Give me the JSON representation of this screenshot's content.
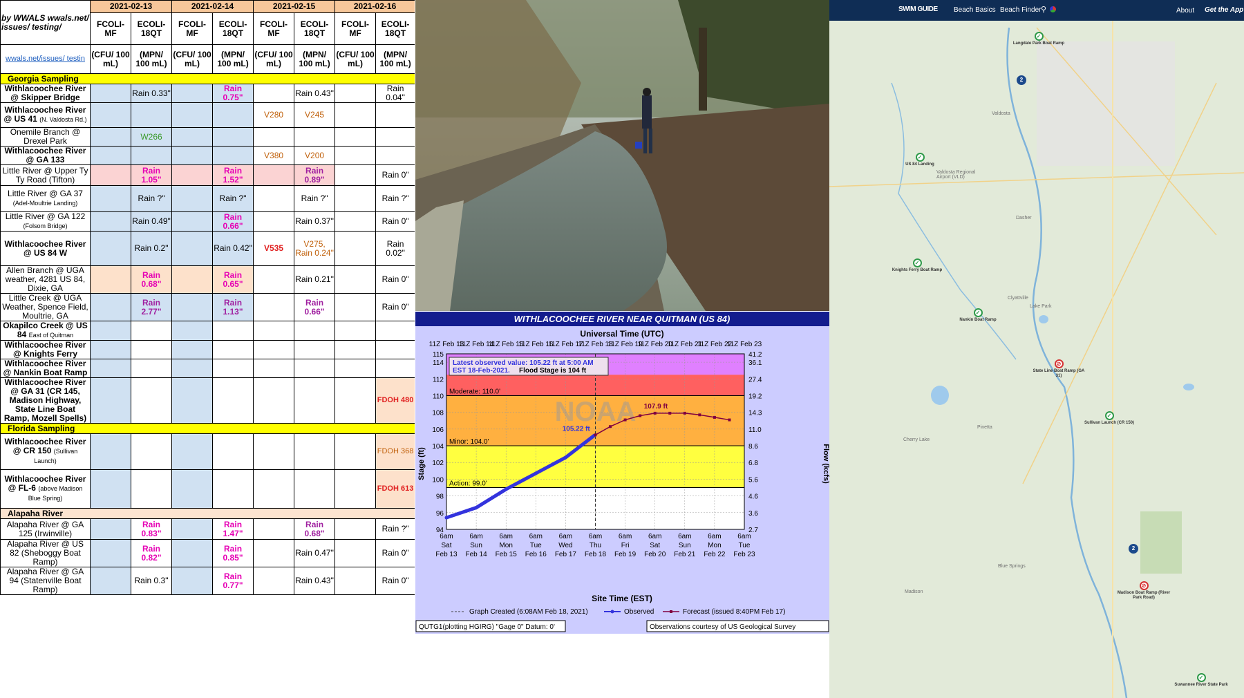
{
  "table": {
    "corner_label": "by WWALS wwals.net/ issues/ testing/",
    "corner_link": "wwals.net/issues/ testin",
    "dates": [
      "2021-02-13",
      "2021-02-14",
      "2021-02-15",
      "2021-02-16"
    ],
    "param_headers": [
      "FCOLI-MF",
      "ECOLI-18QT",
      "FCOLI-MF",
      "ECOLI-18QT",
      "FCOLI-MF",
      "ECOLI-18QT",
      "FCOLI-MF",
      "ECOLI-18QT"
    ],
    "unit_headers": [
      "(CFU/ 100 mL)",
      "(MPN/ 100 mL)",
      "(CFU/ 100 mL)",
      "(MPN/ 100 mL)",
      "(CFU/ 100 mL)",
      "(MPN/ 100 mL)",
      "(CFU/ 100 mL)",
      "(MPN/ 100 mL)"
    ],
    "sections": {
      "georgia": "Georgia Sampling",
      "florida": "Florida Sampling",
      "alapaha": "Alapaha River"
    },
    "rows": [
      {
        "site": "Withlacoochee River @ Skipper Bridge",
        "sub": "",
        "c": [
          "",
          "Rain 0.33\"",
          "",
          "Rain 0.75\"",
          "",
          "Rain 0.43\"",
          "",
          "Rain 0.04\""
        ]
      },
      {
        "site": "Withlacoochee River @ US 41",
        "sub": "(N. Valdosta Rd.)",
        "c": [
          "",
          "",
          "",
          "",
          "V280",
          "V245",
          "",
          ""
        ]
      },
      {
        "site": "Onemile Branch @ Drexel Park",
        "sub": "",
        "c": [
          "",
          "W266",
          "",
          "",
          "",
          "",
          "",
          ""
        ]
      },
      {
        "site": "Withlacoochee River @ GA 133",
        "sub": "",
        "c": [
          "",
          "",
          "",
          "",
          "V380",
          "V200",
          "",
          ""
        ]
      },
      {
        "site": "Little River @ Upper Ty Ty Road (Tifton)",
        "sub": "",
        "c": [
          "",
          "Rain 1.05\"",
          "",
          "Rain 1.52\"",
          "",
          "Rain 0.89\"",
          "",
          "Rain 0\""
        ]
      },
      {
        "site": "Little River @ GA 37",
        "sub": "(Adel-Moultrie Landing)",
        "c": [
          "",
          "Rain ?\"",
          "",
          "Rain ?\"",
          "",
          "Rain ?\"",
          "",
          "Rain ?\""
        ]
      },
      {
        "site": "Little River @ GA 122",
        "sub": "(Folsom Bridge)",
        "c": [
          "",
          "Rain 0.49\"",
          "",
          "Rain 0.66\"",
          "",
          "Rain 0.37\"",
          "",
          "Rain 0\""
        ]
      },
      {
        "site": "Withlacoochee River @ US 84 W",
        "sub": "",
        "c": [
          "",
          "Rain 0.2\"",
          "",
          "Rain 0.42\"",
          "V535",
          "V275, Rain 0.24\"",
          "",
          "Rain 0.02\""
        ]
      },
      {
        "site": "Allen Branch @ UGA weather, 4281 US 84, Dixie, GA",
        "sub": "",
        "c": [
          "",
          "Rain 0.68\"",
          "",
          "Rain 0.65\"",
          "",
          "Rain 0.21\"",
          "",
          "Rain 0\""
        ]
      },
      {
        "site": "Little Creek @ UGA Weather, Spence Field, Moultrie, GA",
        "sub": "",
        "c": [
          "",
          "Rain 2.77\"",
          "",
          "Rain 1.13\"",
          "",
          "Rain 0.66\"",
          "",
          "Rain 0\""
        ]
      },
      {
        "site": "Okapilco Creek @ US 84",
        "sub": "East of Quitman",
        "c": [
          "",
          "",
          "",
          "",
          "",
          "",
          "",
          ""
        ]
      },
      {
        "site": "Withlacoochee River @ Knights Ferry",
        "sub": "",
        "c": [
          "",
          "",
          "",
          "",
          "",
          "",
          "",
          ""
        ]
      },
      {
        "site": "Withlacoochee River @ Nankin Boat Ramp",
        "sub": "",
        "c": [
          "",
          "",
          "",
          "",
          "",
          "",
          "",
          ""
        ]
      },
      {
        "site": "Withlacoochee River @ GA 31 (CR 145, Madison Highway, State Line Boat Ramp, Mozell Spells)",
        "sub": "",
        "c": [
          "",
          "",
          "",
          "",
          "",
          "",
          "",
          "FDOH 480"
        ]
      },
      {
        "site": "Withlacoochee River @ CR 150",
        "sub": "(Sullivan Launch)",
        "c": [
          "",
          "",
          "",
          "",
          "",
          "",
          "",
          "FDOH 368"
        ]
      },
      {
        "site": "Withlacoochee River @ FL-6",
        "sub": "(above Madison Blue Spring)",
        "c": [
          "",
          "",
          "",
          "",
          "",
          "",
          "",
          "FDOH 613"
        ]
      },
      {
        "site": "Alapaha River @ GA 125 (Irwinville)",
        "sub": "",
        "c": [
          "",
          "Rain 0.83\"",
          "",
          "Rain 1.47\"",
          "",
          "Rain 0.68\"",
          "",
          "Rain ?\""
        ]
      },
      {
        "site": "Alapaha River @ US 82 (Sheboggy Boat Ramp)",
        "sub": "",
        "c": [
          "",
          "Rain 0.82\"",
          "",
          "Rain 0.85\"",
          "",
          "Rain 0.47\"",
          "",
          "Rain 0\""
        ]
      },
      {
        "site": "Alapaha River @ GA 94 (Statenville Boat Ramp)",
        "sub": "",
        "c": [
          "",
          "Rain 0.3\"",
          "",
          "Rain 0.77\"",
          "",
          "Rain 0.43\"",
          "",
          "Rain 0\""
        ]
      }
    ]
  },
  "hydrograph": {
    "title": "WITHLACOOCHEE RIVER NEAR QUITMAN (US 84)",
    "top_axis_title": "Universal Time (UTC)",
    "bottom_axis_title": "Site Time (EST)",
    "latest_text_1": "Latest observed value: 105.22  ft at 5:00 AM",
    "latest_text_2": "EST 18-Feb-2021.",
    "latest_text_3": "Flood Stage is 104 ft",
    "obs_label": "105.22 ft",
    "fc_label": "107.9 ft",
    "left_axis": "Stage (ft)",
    "right_axis": "Flow (kcfs)",
    "moderate_label": "Moderate: 110.0'",
    "minor_label": "Minor: 104.0'",
    "action_label": "Action: 99.0'",
    "utc_ticks": [
      "11Z Feb 13",
      "11Z Feb 14",
      "11Z Feb 15",
      "11Z Feb 16",
      "11Z Feb 17",
      "11Z Feb 18",
      "11Z Feb 19",
      "11Z Feb 20",
      "11Z Feb 21",
      "11Z Feb 22",
      "11Z Feb 23"
    ],
    "est_ticks": [
      [
        "6am",
        "Sat",
        "Feb 13"
      ],
      [
        "6am",
        "Sun",
        "Feb 14"
      ],
      [
        "6am",
        "Mon",
        "Feb 15"
      ],
      [
        "6am",
        "Tue",
        "Feb 16"
      ],
      [
        "6am",
        "Wed",
        "Feb 17"
      ],
      [
        "6am",
        "Thu",
        "Feb 18"
      ],
      [
        "6am",
        "Fri",
        "Feb 19"
      ],
      [
        "6am",
        "Sat",
        "Feb 20"
      ],
      [
        "6am",
        "Sun",
        "Feb 21"
      ],
      [
        "6am",
        "Mon",
        "Feb 22"
      ],
      [
        "6am",
        "Tue",
        "Feb 23"
      ]
    ],
    "stage_ticks": [
      "94",
      "96",
      "98",
      "100",
      "102",
      "104",
      "106",
      "108",
      "110",
      "112",
      "114",
      "115"
    ],
    "flow_ticks": [
      "2.7",
      "3.6",
      "4.6",
      "5.6",
      "6.8",
      "8.6",
      "11.0",
      "14.3",
      "19.2",
      "27.4",
      "36.1",
      "41.2"
    ],
    "legend_created": "Graph Created (6:08AM Feb 18, 2021)",
    "legend_observed": "Observed",
    "legend_forecast": "Forecast (issued 8:40PM Feb 17)",
    "footer_left": "QUTG1(plotting HGIRG) \"Gage 0\" Datum: 0'",
    "footer_right": "Observations courtesy of US Geological Survey",
    "watermark": "NOAA",
    "colors": {
      "observed": "#3333dd",
      "forecast": "#800040",
      "moderate": "#ff6060",
      "minor": "#ffb040",
      "action": "#ffff40",
      "major": "#e080ff"
    }
  },
  "chart_data": {
    "type": "line",
    "title": "WITHLACOOCHEE RIVER NEAR QUITMAN (US 84)",
    "xlabel": "Site Time (EST)",
    "ylabel": "Stage (ft)",
    "ylim": [
      94,
      115
    ],
    "x_ticks": [
      "Feb 13",
      "Feb 14",
      "Feb 15",
      "Feb 16",
      "Feb 17",
      "Feb 18",
      "Feb 19",
      "Feb 20",
      "Feb 21",
      "Feb 22",
      "Feb 23"
    ],
    "series": [
      {
        "name": "Observed",
        "x": [
          "Feb 13 6am",
          "Feb 14 6am",
          "Feb 15 6am",
          "Feb 16 6am",
          "Feb 17 6am",
          "Feb 18 5am"
        ],
        "values": [
          95.4,
          96.6,
          98.8,
          100.7,
          102.6,
          105.22
        ]
      },
      {
        "name": "Forecast",
        "x": [
          "Feb 18 6am",
          "Feb 18 18h",
          "Feb 19 6am",
          "Feb 19 18h",
          "Feb 20 6am",
          "Feb 20 18h",
          "Feb 21 6am",
          "Feb 21 18h",
          "Feb 22 6am",
          "Feb 22 18h"
        ],
        "values": [
          105.3,
          106.3,
          107.1,
          107.6,
          107.9,
          107.9,
          107.9,
          107.7,
          107.4,
          107.1
        ]
      }
    ]
  },
  "map": {
    "logo_text": "SWIM GUIDE",
    "nav": [
      "Beach Basics",
      "Beach Finder"
    ],
    "about": "About",
    "app": "Get the App",
    "places": [
      "Valdosta",
      "Valdosta Regional Airport (VLD)",
      "Dasher",
      "Clyattville",
      "Lake Park",
      "Cherry Lake",
      "Pinetta",
      "Madison",
      "Blue Springs"
    ],
    "markers": [
      {
        "label": "Langdale Park Boat Ramp",
        "status": "good"
      },
      {
        "label": "US 84 Landing",
        "status": "good"
      },
      {
        "label": "Knights Ferry Boat Ramp",
        "status": "good"
      },
      {
        "label": "Nankin Boat Ramp",
        "status": "good"
      },
      {
        "label": "State Line Boat Ramp (GA 31)",
        "status": "bad"
      },
      {
        "label": "Sullivan Launch (CR 150)",
        "status": "good"
      },
      {
        "label": "Madison Boat Ramp (River Park Road)",
        "status": "bad"
      },
      {
        "label": "Suwannee River State Park",
        "status": "good"
      }
    ],
    "cluster_count": "2"
  }
}
